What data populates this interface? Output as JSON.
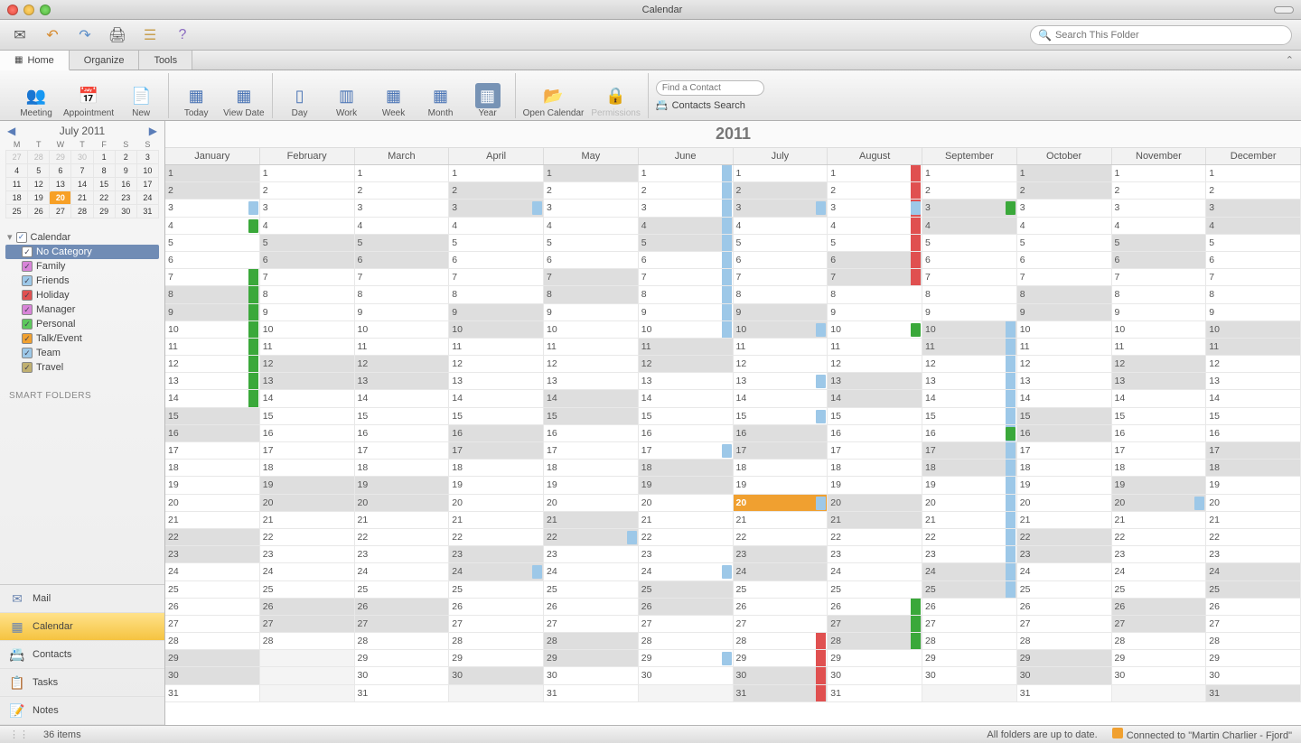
{
  "window": {
    "title": "Calendar"
  },
  "search": {
    "placeholder": "Search This Folder"
  },
  "tabs": {
    "home": "Home",
    "organize": "Organize",
    "tools": "Tools"
  },
  "ribbon": {
    "meeting": "Meeting",
    "appointment": "Appointment",
    "new": "New",
    "today": "Today",
    "viewdate": "View Date",
    "day": "Day",
    "work": "Work",
    "week": "Week",
    "month": "Month",
    "year": "Year",
    "opencal": "Open Calendar",
    "permissions": "Permissions",
    "findcontact": "Find a Contact",
    "contactsearch": "Contacts Search"
  },
  "minical": {
    "label": "July 2011",
    "dow": [
      "M",
      "T",
      "W",
      "T",
      "F",
      "S",
      "S"
    ],
    "weeks": [
      [
        {
          "d": 27,
          "o": 1
        },
        {
          "d": 28,
          "o": 1
        },
        {
          "d": 29,
          "o": 1
        },
        {
          "d": 30,
          "o": 1
        },
        {
          "d": 1
        },
        {
          "d": 2
        },
        {
          "d": 3
        }
      ],
      [
        {
          "d": 4
        },
        {
          "d": 5
        },
        {
          "d": 6
        },
        {
          "d": 7
        },
        {
          "d": 8
        },
        {
          "d": 9
        },
        {
          "d": 10
        }
      ],
      [
        {
          "d": 11
        },
        {
          "d": 12
        },
        {
          "d": 13
        },
        {
          "d": 14
        },
        {
          "d": 15
        },
        {
          "d": 16
        },
        {
          "d": 17
        }
      ],
      [
        {
          "d": 18
        },
        {
          "d": 19
        },
        {
          "d": 20,
          "t": 1
        },
        {
          "d": 21
        },
        {
          "d": 22
        },
        {
          "d": 23
        },
        {
          "d": 24
        }
      ],
      [
        {
          "d": 25
        },
        {
          "d": 26
        },
        {
          "d": 27
        },
        {
          "d": 28
        },
        {
          "d": 29
        },
        {
          "d": 30
        },
        {
          "d": 31
        }
      ]
    ]
  },
  "categories": {
    "root": "Calendar",
    "items": [
      {
        "label": "No Category",
        "color": "#ffffff",
        "selected": true
      },
      {
        "label": "Family",
        "color": "#d884d8"
      },
      {
        "label": "Friends",
        "color": "#9dc8e8"
      },
      {
        "label": "Holiday",
        "color": "#e05050"
      },
      {
        "label": "Manager",
        "color": "#d884d8"
      },
      {
        "label": "Personal",
        "color": "#5cc85c"
      },
      {
        "label": "Talk/Event",
        "color": "#f0a030"
      },
      {
        "label": "Team",
        "color": "#9dc8e8"
      },
      {
        "label": "Travel",
        "color": "#c0b070"
      }
    ]
  },
  "smart_folders": "SMART FOLDERS",
  "nav": {
    "mail": "Mail",
    "calendar": "Calendar",
    "contacts": "Contacts",
    "tasks": "Tasks",
    "notes": "Notes"
  },
  "year": {
    "title": "2011",
    "months": [
      "January",
      "February",
      "March",
      "April",
      "May",
      "June",
      "July",
      "August",
      "September",
      "October",
      "November",
      "December"
    ],
    "days_in_month": [
      31,
      28,
      31,
      30,
      31,
      30,
      31,
      31,
      30,
      31,
      30,
      31
    ],
    "first_weekday": [
      5,
      1,
      1,
      4,
      6,
      2,
      4,
      0,
      3,
      5,
      1,
      3
    ],
    "today": {
      "month": 7,
      "day": 20
    },
    "events": [
      {
        "m": 1,
        "d": 4,
        "color": "#3aa83a"
      },
      {
        "m": 1,
        "d": 7,
        "from": 7,
        "to": 14,
        "color": "#3aa83a",
        "bar": true
      },
      {
        "m": 1,
        "d": 3,
        "color": "#9dc8e8"
      },
      {
        "m": 4,
        "d": 3,
        "color": "#9dc8e8"
      },
      {
        "m": 4,
        "d": 24,
        "color": "#9dc8e8"
      },
      {
        "m": 5,
        "d": 22,
        "color": "#9dc8e8"
      },
      {
        "m": 6,
        "d": 1,
        "from": 1,
        "to": 10,
        "color": "#9dc8e8",
        "bar": true
      },
      {
        "m": 6,
        "d": 17,
        "color": "#9dc8e8"
      },
      {
        "m": 6,
        "d": 24,
        "color": "#9dc8e8"
      },
      {
        "m": 6,
        "d": 29,
        "color": "#9dc8e8"
      },
      {
        "m": 7,
        "d": 3,
        "color": "#9dc8e8"
      },
      {
        "m": 7,
        "d": 10,
        "color": "#9dc8e8"
      },
      {
        "m": 7,
        "d": 13,
        "color": "#9dc8e8"
      },
      {
        "m": 7,
        "d": 15,
        "color": "#9dc8e8"
      },
      {
        "m": 7,
        "d": 20,
        "color": "#9dc8e8"
      },
      {
        "m": 7,
        "d": 28,
        "from": 28,
        "to": 31,
        "color": "#e05050",
        "bar": true
      },
      {
        "m": 8,
        "d": 1,
        "from": 1,
        "to": 7,
        "color": "#e05050",
        "bar": true
      },
      {
        "m": 8,
        "d": 3,
        "color": "#9dc8e8"
      },
      {
        "m": 8,
        "d": 10,
        "color": "#3aa83a"
      },
      {
        "m": 8,
        "d": 26,
        "from": 26,
        "to": 28,
        "color": "#3aa83a",
        "bar": true
      },
      {
        "m": 9,
        "d": 3,
        "color": "#3aa83a"
      },
      {
        "m": 9,
        "d": 10,
        "from": 10,
        "to": 25,
        "color": "#9dc8e8",
        "bar": true
      },
      {
        "m": 9,
        "d": 16,
        "color": "#3aa83a"
      },
      {
        "m": 11,
        "d": 20,
        "color": "#9dc8e8"
      }
    ]
  },
  "status": {
    "items": "36 items",
    "sync": "All folders are up to date.",
    "conn": "Connected to \"Martin Charlier - Fjord\""
  }
}
